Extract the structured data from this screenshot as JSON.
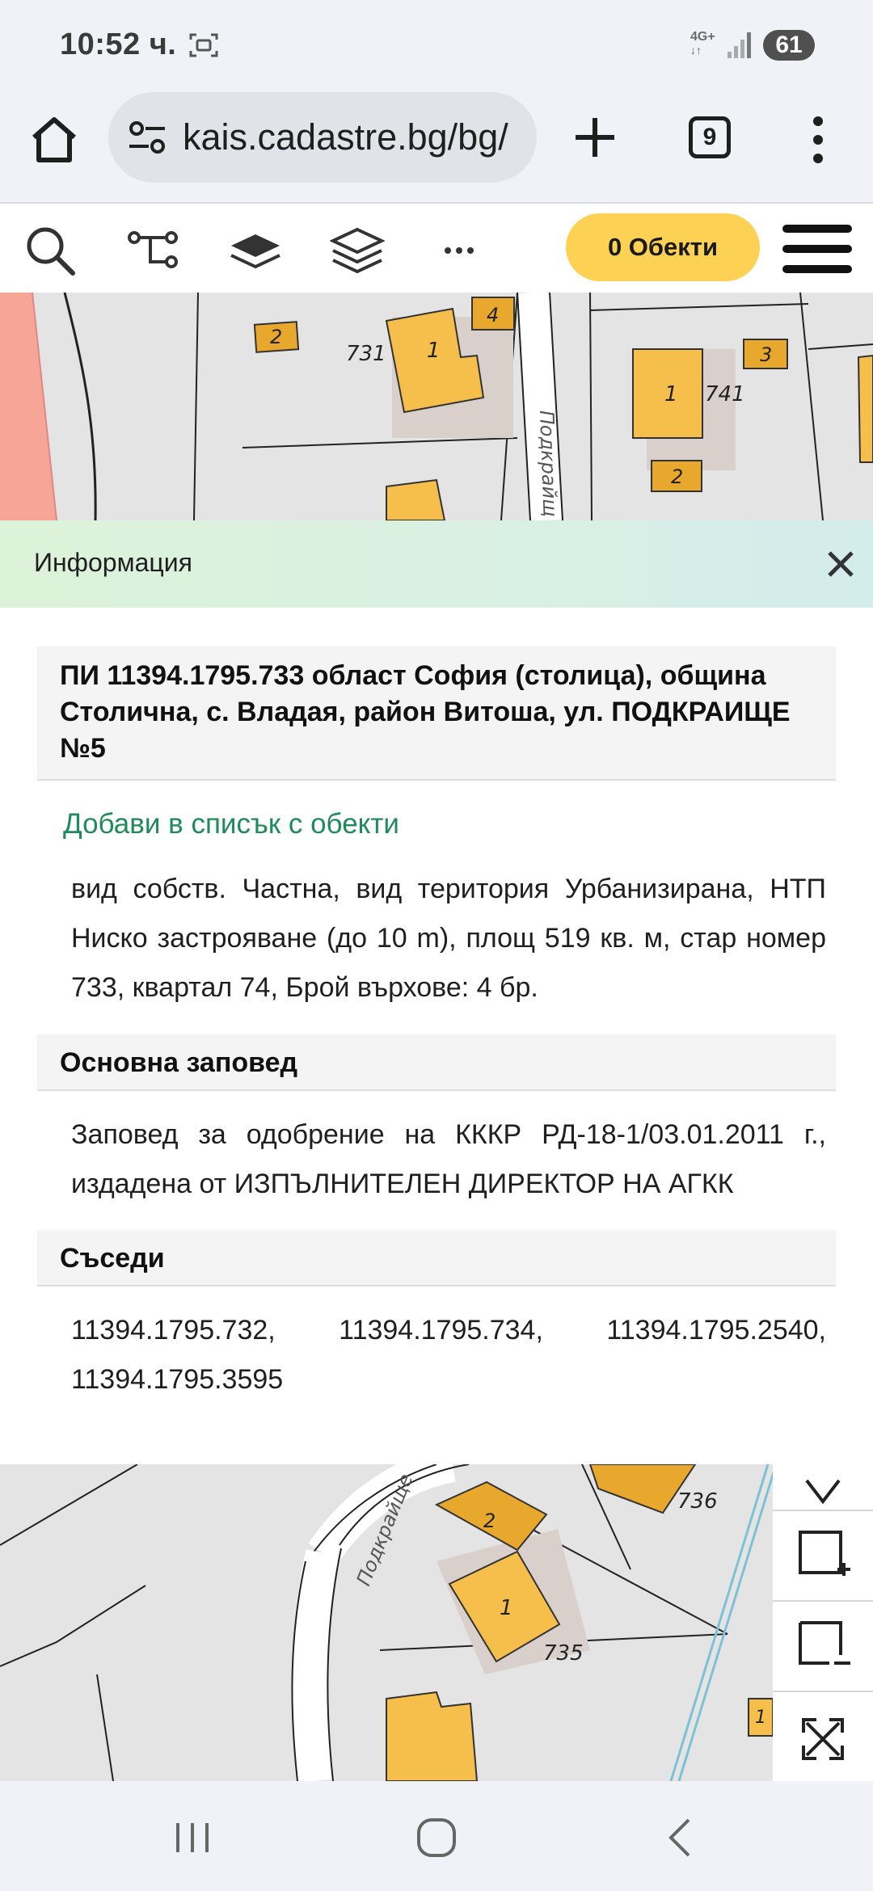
{
  "status_bar": {
    "time": "10:52 ч.",
    "network": "4G+",
    "battery": "61"
  },
  "browser": {
    "url": "kais.cadastre.bg/bg/",
    "tab_count": "9"
  },
  "toolbar": {
    "objects_label": "0 Обекти",
    "accent_color": "#fdd153"
  },
  "map": {
    "top": {
      "parcels": [
        "731",
        "741"
      ],
      "buildings": [
        "2",
        "1",
        "4",
        "1",
        "3",
        "2"
      ],
      "street": "Подкрайщ"
    },
    "bottom": {
      "parcels": [
        "736",
        "735"
      ],
      "buildings": [
        "2",
        "1",
        "1"
      ],
      "street": "Подкрайще"
    }
  },
  "info_panel": {
    "title": "Информация",
    "parcel_heading": "ПИ 11394.1795.733 област София (столица), община Столична, с. Владая, район Витоша, ул. ПОДКРАИЩЕ №5",
    "add_link": "Добави в списък с обекти",
    "details": "вид собств. Частна, вид територия Урбанизирана, НТП Ниско застрояване (до 10 m), площ 519 кв. м, стар номер 733, квартал 74, Брой върхове: 4 бр.",
    "order_heading": "Основна заповед",
    "order_text": "Заповед за одобрение на КККР РД-18-1/03.01.2011 г., издадена от ИЗПЪЛНИТЕЛЕН ДИРЕКТОР НА АГКК",
    "neighbors_heading": "Съседи",
    "neighbors_text": "11394.1795.732, 11394.1795.734, 11394.1795.2540, 11394.1795.3595",
    "link_color": "#1f8a5c"
  }
}
